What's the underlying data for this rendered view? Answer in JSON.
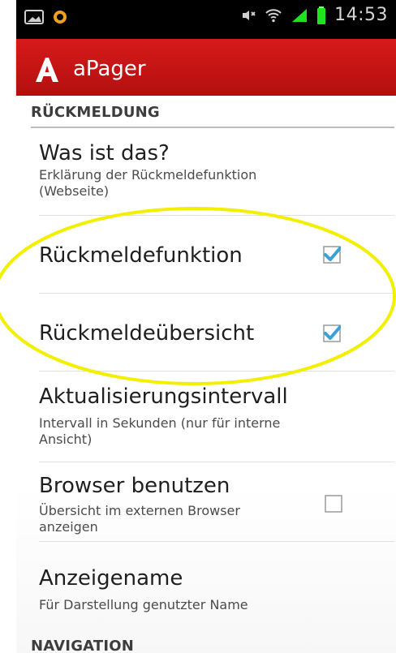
{
  "status_bar": {
    "time": "14:53",
    "icons": [
      "picture-icon",
      "orange-circle-icon",
      "mute-icon",
      "wifi-icon",
      "signal-icon",
      "battery-icon"
    ]
  },
  "app_bar": {
    "logo_letter": "A",
    "title": "aPager",
    "accent": "#c81414"
  },
  "sections": {
    "feedback": {
      "header": "RÜCKMELDUNG",
      "items": [
        {
          "title": "Was ist das?",
          "summary": "Erklärung der Rückmeldefunktion (Webseite)"
        },
        {
          "title": "Rückmeldefunktion",
          "checked": true
        },
        {
          "title": "Rückmeldeübersicht",
          "checked": true
        },
        {
          "title": "Aktualisierungsintervall",
          "summary": "Intervall in Sekunden (nur für interne Ansicht)"
        },
        {
          "title": "Browser benutzen",
          "summary": "Übersicht im externen Browser anzeigen",
          "checked": false
        },
        {
          "title": "Anzeigename",
          "summary": "Für Darstellung genutzter Name"
        }
      ]
    },
    "navigation": {
      "header": "NAVIGATION"
    }
  },
  "colors": {
    "checkbox_check": "#3aa0d8",
    "annotation_yellow": "#f2f000"
  }
}
